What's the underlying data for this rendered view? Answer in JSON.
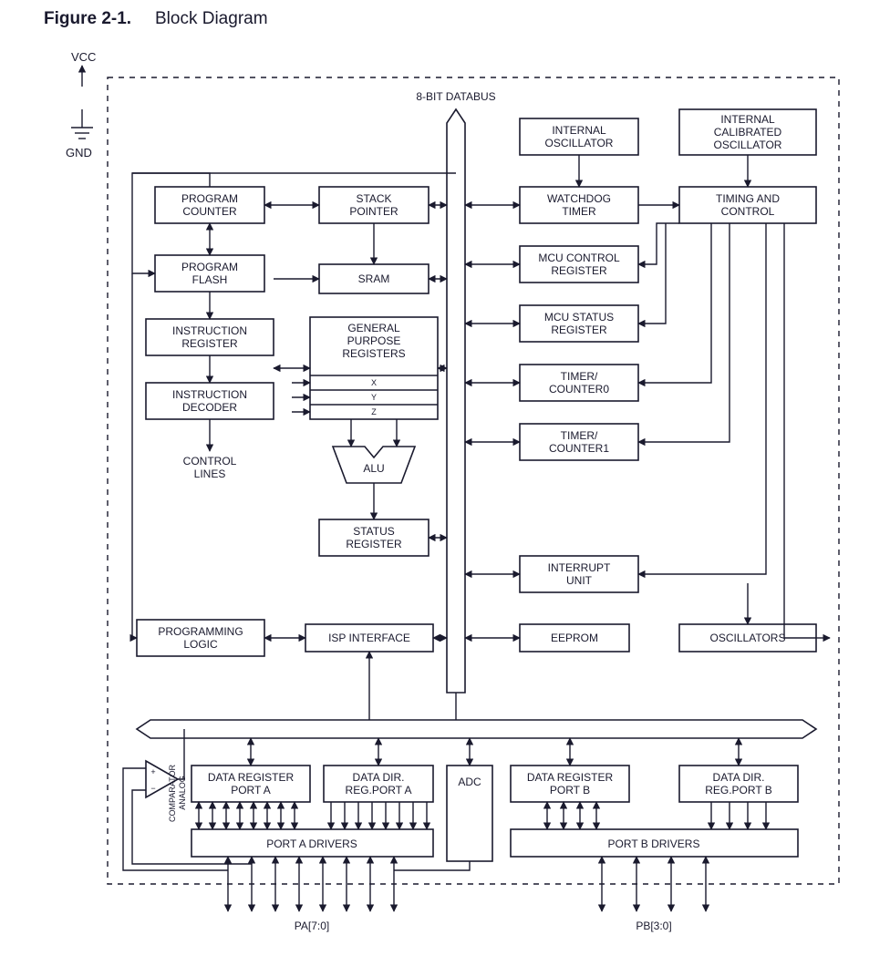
{
  "figure": {
    "label": "Figure 2-1.",
    "title": "Block Diagram"
  },
  "pins": {
    "vcc": "VCC",
    "gnd": "GND",
    "pa": "PA[7:0]",
    "pb": "PB[3:0]"
  },
  "bus": {
    "databus": "8-BIT DATABUS"
  },
  "blocks": {
    "program_counter": "PROGRAM COUNTER",
    "program_flash": "PROGRAM FLASH",
    "instruction_register": "INSTRUCTION REGISTER",
    "instruction_decoder": "INSTRUCTION DECODER",
    "control_lines": "CONTROL LINES",
    "stack_pointer": "STACK POINTER",
    "sram": "SRAM",
    "gpr": "GENERAL PURPOSE REGISTERS",
    "x": "X",
    "y": "Y",
    "z": "Z",
    "alu": "ALU",
    "status_register": "STATUS REGISTER",
    "internal_oscillator": "INTERNAL OSCILLATOR",
    "internal_calibrated_oscillator": "INTERNAL CALIBRATED OSCILLATOR",
    "watchdog_timer": "WATCHDOG TIMER",
    "timing_and_control": "TIMING AND CONTROL",
    "mcu_control_register": "MCU CONTROL REGISTER",
    "mcu_status_register": "MCU STATUS REGISTER",
    "timer_counter0": "TIMER/ COUNTER0",
    "timer_counter1": "TIMER/ COUNTER1",
    "interrupt_unit": "INTERRUPT UNIT",
    "programming_logic": "PROGRAMMING LOGIC",
    "isp_interface": "ISP INTERFACE",
    "eeprom": "EEPROM",
    "oscillators": "OSCILLATORS",
    "data_register_port_a": "DATA REGISTER PORT A",
    "data_dir_reg_port_a": "DATA DIR. REG.PORT A",
    "adc": "ADC",
    "data_register_port_b": "DATA REGISTER PORT B",
    "data_dir_reg_port_b": "DATA DIR. REG.PORT B",
    "port_a_drivers": "PORT A DRIVERS",
    "port_b_drivers": "PORT B DRIVERS",
    "analog_comparator": "ANALOG COMPARATOR",
    "comp_plus": "+",
    "comp_minus": "−"
  }
}
